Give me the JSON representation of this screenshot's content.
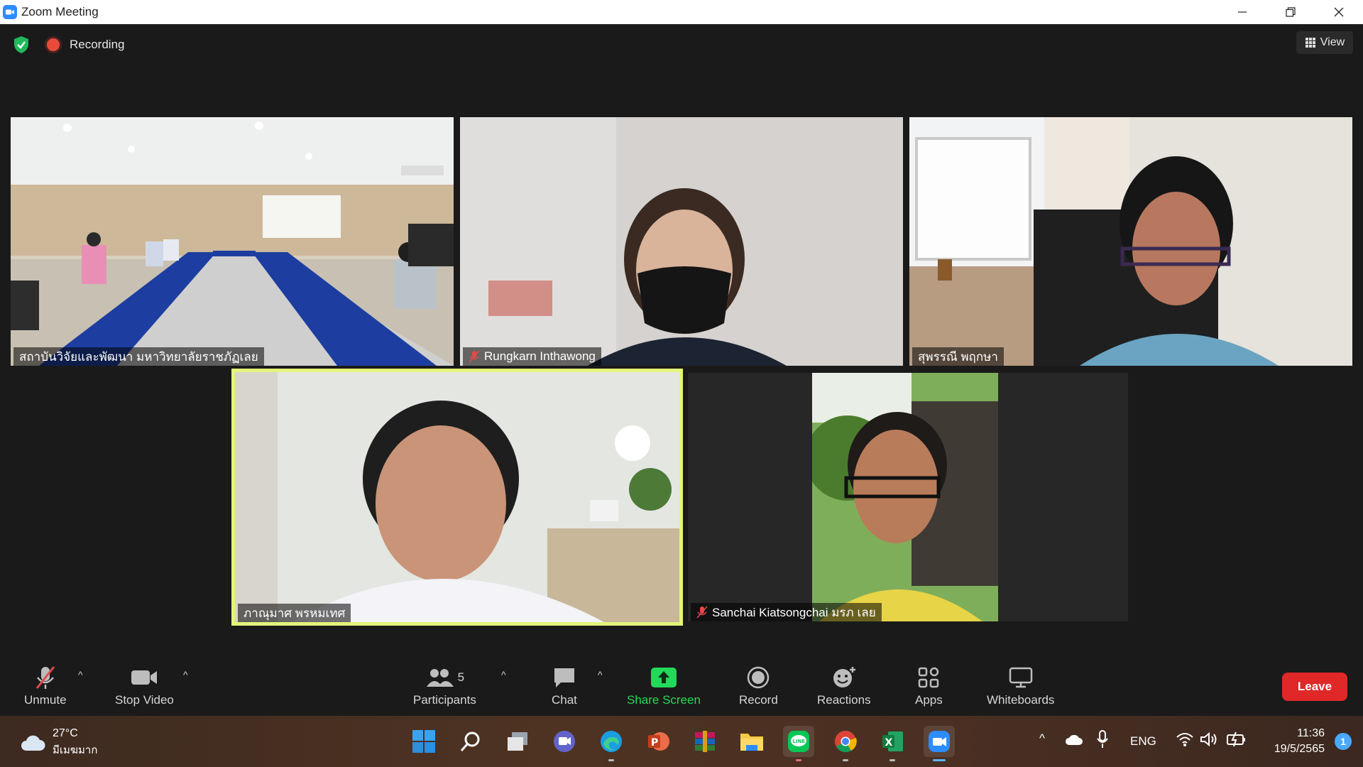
{
  "window": {
    "title": "Zoom Meeting"
  },
  "meeting": {
    "recording_label": "Recording",
    "view_label": "View"
  },
  "tiles": [
    {
      "name": "สถาบันวิจัยและพัฒนา มหาวิทยาลัยราชภัฏเลย",
      "muted": false
    },
    {
      "name": "Rungkarn Inthawong",
      "muted": true
    },
    {
      "name": "สุพรรณี พฤกษา",
      "muted": false
    },
    {
      "name": "ภาณุมาศ พรหมเทศ",
      "muted": false,
      "active_speaker": true
    },
    {
      "name": "Sanchai Kiatsongchai มรภ เลย",
      "muted": true
    }
  ],
  "toolbar": {
    "unmute": "Unmute",
    "stop_video": "Stop Video",
    "participants": "Participants",
    "participants_count": "5",
    "chat": "Chat",
    "share_screen": "Share Screen",
    "record": "Record",
    "reactions": "Reactions",
    "apps": "Apps",
    "whiteboards": "Whiteboards",
    "leave": "Leave"
  },
  "taskbar": {
    "weather_temp": "27°C",
    "weather_desc": "มีเมฆมาก",
    "language": "ENG",
    "time": "11:36",
    "date": "19/5/2565",
    "notification_count": "1",
    "apps": [
      "start-icon",
      "search-icon",
      "task-view-icon",
      "teams-chat-icon",
      "edge-icon",
      "powerpoint-icon",
      "winrar-icon",
      "file-explorer-icon",
      "line-icon",
      "chrome-icon",
      "excel-icon",
      "zoom-icon"
    ]
  },
  "colors": {
    "accent_green": "#23d959",
    "leave_red": "#e02828",
    "speaker_border": "#e4f47a",
    "zoom_blue": "#2d8cff"
  }
}
